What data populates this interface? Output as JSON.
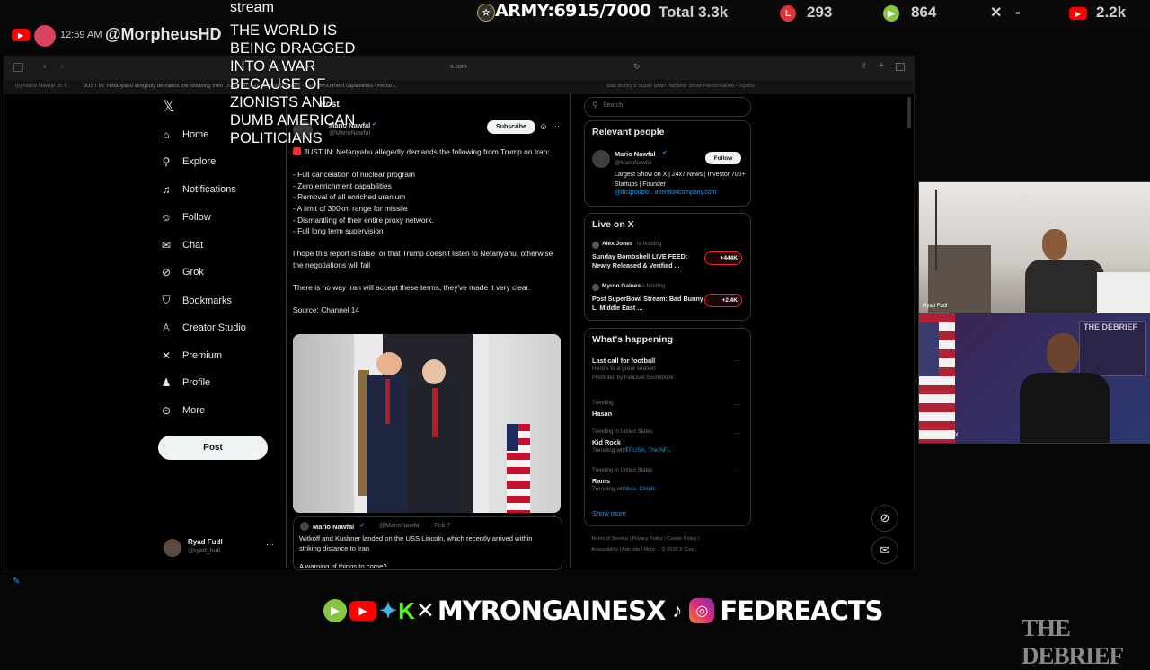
{
  "stream": {
    "time": "12:59 AM",
    "handle": "@MorpheusHD",
    "overlay_title": "stream",
    "overlay_message": "THE WORLD IS BEING DRAGGED INTO A WAR BECAUSE OF ZIONISTS AND DUMB AMERICAN POLITICIANS",
    "army_goal": "ARMY:6915/7000",
    "total": "Total 3.3k",
    "stat_red": "293",
    "stat_green": "864",
    "stat_x": "-",
    "stat_youtube": "2.2k"
  },
  "browser": {
    "url": "x.com",
    "tabs": [
      "(6) Mario Nawfal on X",
      "JUST IN: Netanyahu allegedly demands the following from Trump on Iran: nuclear program - Zero enrichment capabilities - Remo...",
      "Bad Bunny's Super Bowl Halftime Show Performance - Sports"
    ]
  },
  "sidebar": {
    "items": [
      {
        "label": "Home",
        "icon": "home-icon",
        "glyph": "⌂"
      },
      {
        "label": "Explore",
        "icon": "search-icon",
        "glyph": "⚲"
      },
      {
        "label": "Notifications",
        "icon": "bell-icon",
        "glyph": "♫"
      },
      {
        "label": "Follow",
        "icon": "add-person-icon",
        "glyph": "☺"
      },
      {
        "label": "Chat",
        "icon": "mail-icon",
        "glyph": "✉"
      },
      {
        "label": "Grok",
        "icon": "grok-icon",
        "glyph": "⊘"
      },
      {
        "label": "Bookmarks",
        "icon": "bookmark-icon",
        "glyph": "⛉"
      },
      {
        "label": "Creator Studio",
        "icon": "creator-icon",
        "glyph": "♙"
      },
      {
        "label": "Premium",
        "icon": "x-icon",
        "glyph": "✕"
      },
      {
        "label": "Profile",
        "icon": "person-icon",
        "glyph": "♟"
      },
      {
        "label": "More",
        "icon": "more-circle-icon",
        "glyph": "⊙"
      }
    ],
    "post_label": "Post",
    "account_name": "Ryad Fudl",
    "account_handle": "@ryad_fudl"
  },
  "post": {
    "header": "Post",
    "author": "Mario Nawfal",
    "handle": "@MarioNawfal",
    "subscribe_label": "Subscribe",
    "text": "JUST IN: Netanyahu allegedly demands the following from Trump on Iran:\n\n- Full cancelation of nuclear program\n- Zero enrichment capabilities\n- Removal of all enriched uranium\n- A limit of 300km range for missile\n- Dismantling of their entire proxy network.\n- Full long term supervision\n\nI hope this report is false, or that Trump doesn't listen to Netanyahu, otherwise the negotiations will fail\n\nThere is no way Iran will accept these terms, they've made it very clear.\n\nSource: Channel 14",
    "quoted": {
      "author": "Mario Nawfal",
      "handle": "@MarioNawfal",
      "date": "· Feb 7",
      "text": "Witkoff and Kushner landed on the USS Lincoln, which recently arrived within striking distance to Iran",
      "text2": "A warning of things to come?"
    }
  },
  "right": {
    "search_placeholder": "Search",
    "relevant_title": "Relevant people",
    "person": {
      "name": "Mario Nawfal",
      "handle": "@MarioNawfal",
      "follow": "Follow",
      "bio": "Largest Show on X | 24x7 News | Investor 700+ Startups | Founder",
      "links": "@ibcgroupio , attentioncompany.com"
    },
    "live_title": "Live on X",
    "live": [
      {
        "host": "Alex Jones",
        "status": "is hosting",
        "title": "Sunday Bombshell LIVE FEED: Newly Released & Verified ...",
        "count": "+444K"
      },
      {
        "host": "Myron Gaines",
        "status": "is hosting",
        "title": "Post SuperBowl Stream: Bad Bunny L, Middle East ...",
        "count": "+2.4K"
      }
    ],
    "happening_title": "What's happening",
    "trends": [
      {
        "context": "",
        "name": "Last call for football",
        "sub": "Here's to a great season",
        "extra": "Promoted by FanDuel Sportsbook"
      },
      {
        "context": "Trending",
        "name": "Hasan",
        "sub": "",
        "extra": ""
      },
      {
        "context": "Trending in United States",
        "name": "Kid Rock",
        "sub": "Trending with",
        "extra": "TPUSA, The NFL"
      },
      {
        "context": "Trending in United States",
        "name": "Rams",
        "sub": "Trending with",
        "extra": "Jets, Chiefs"
      }
    ],
    "show_more": "Show more",
    "footer1": "Terms of Service  |  Privacy Policy  |  Cookie Policy  |",
    "footer2": "Accessibility  |  Ads info  |  More ...  © 2026 X Corp."
  },
  "cams": {
    "top_label": "Ryad Fudl",
    "bottom_label": "MyronGainesX",
    "bottom_poster": "THE DEBRIEF"
  },
  "banner": {
    "handle": "MYRONGAINESX",
    "handle2": "FEDREACTS",
    "logo": "THE DEBRIEF"
  },
  "colors": {
    "accent": "#1d9bf0",
    "youtube_red": "#ff0000",
    "rumble_green": "#85c742",
    "live_pill": "#f4212e"
  }
}
